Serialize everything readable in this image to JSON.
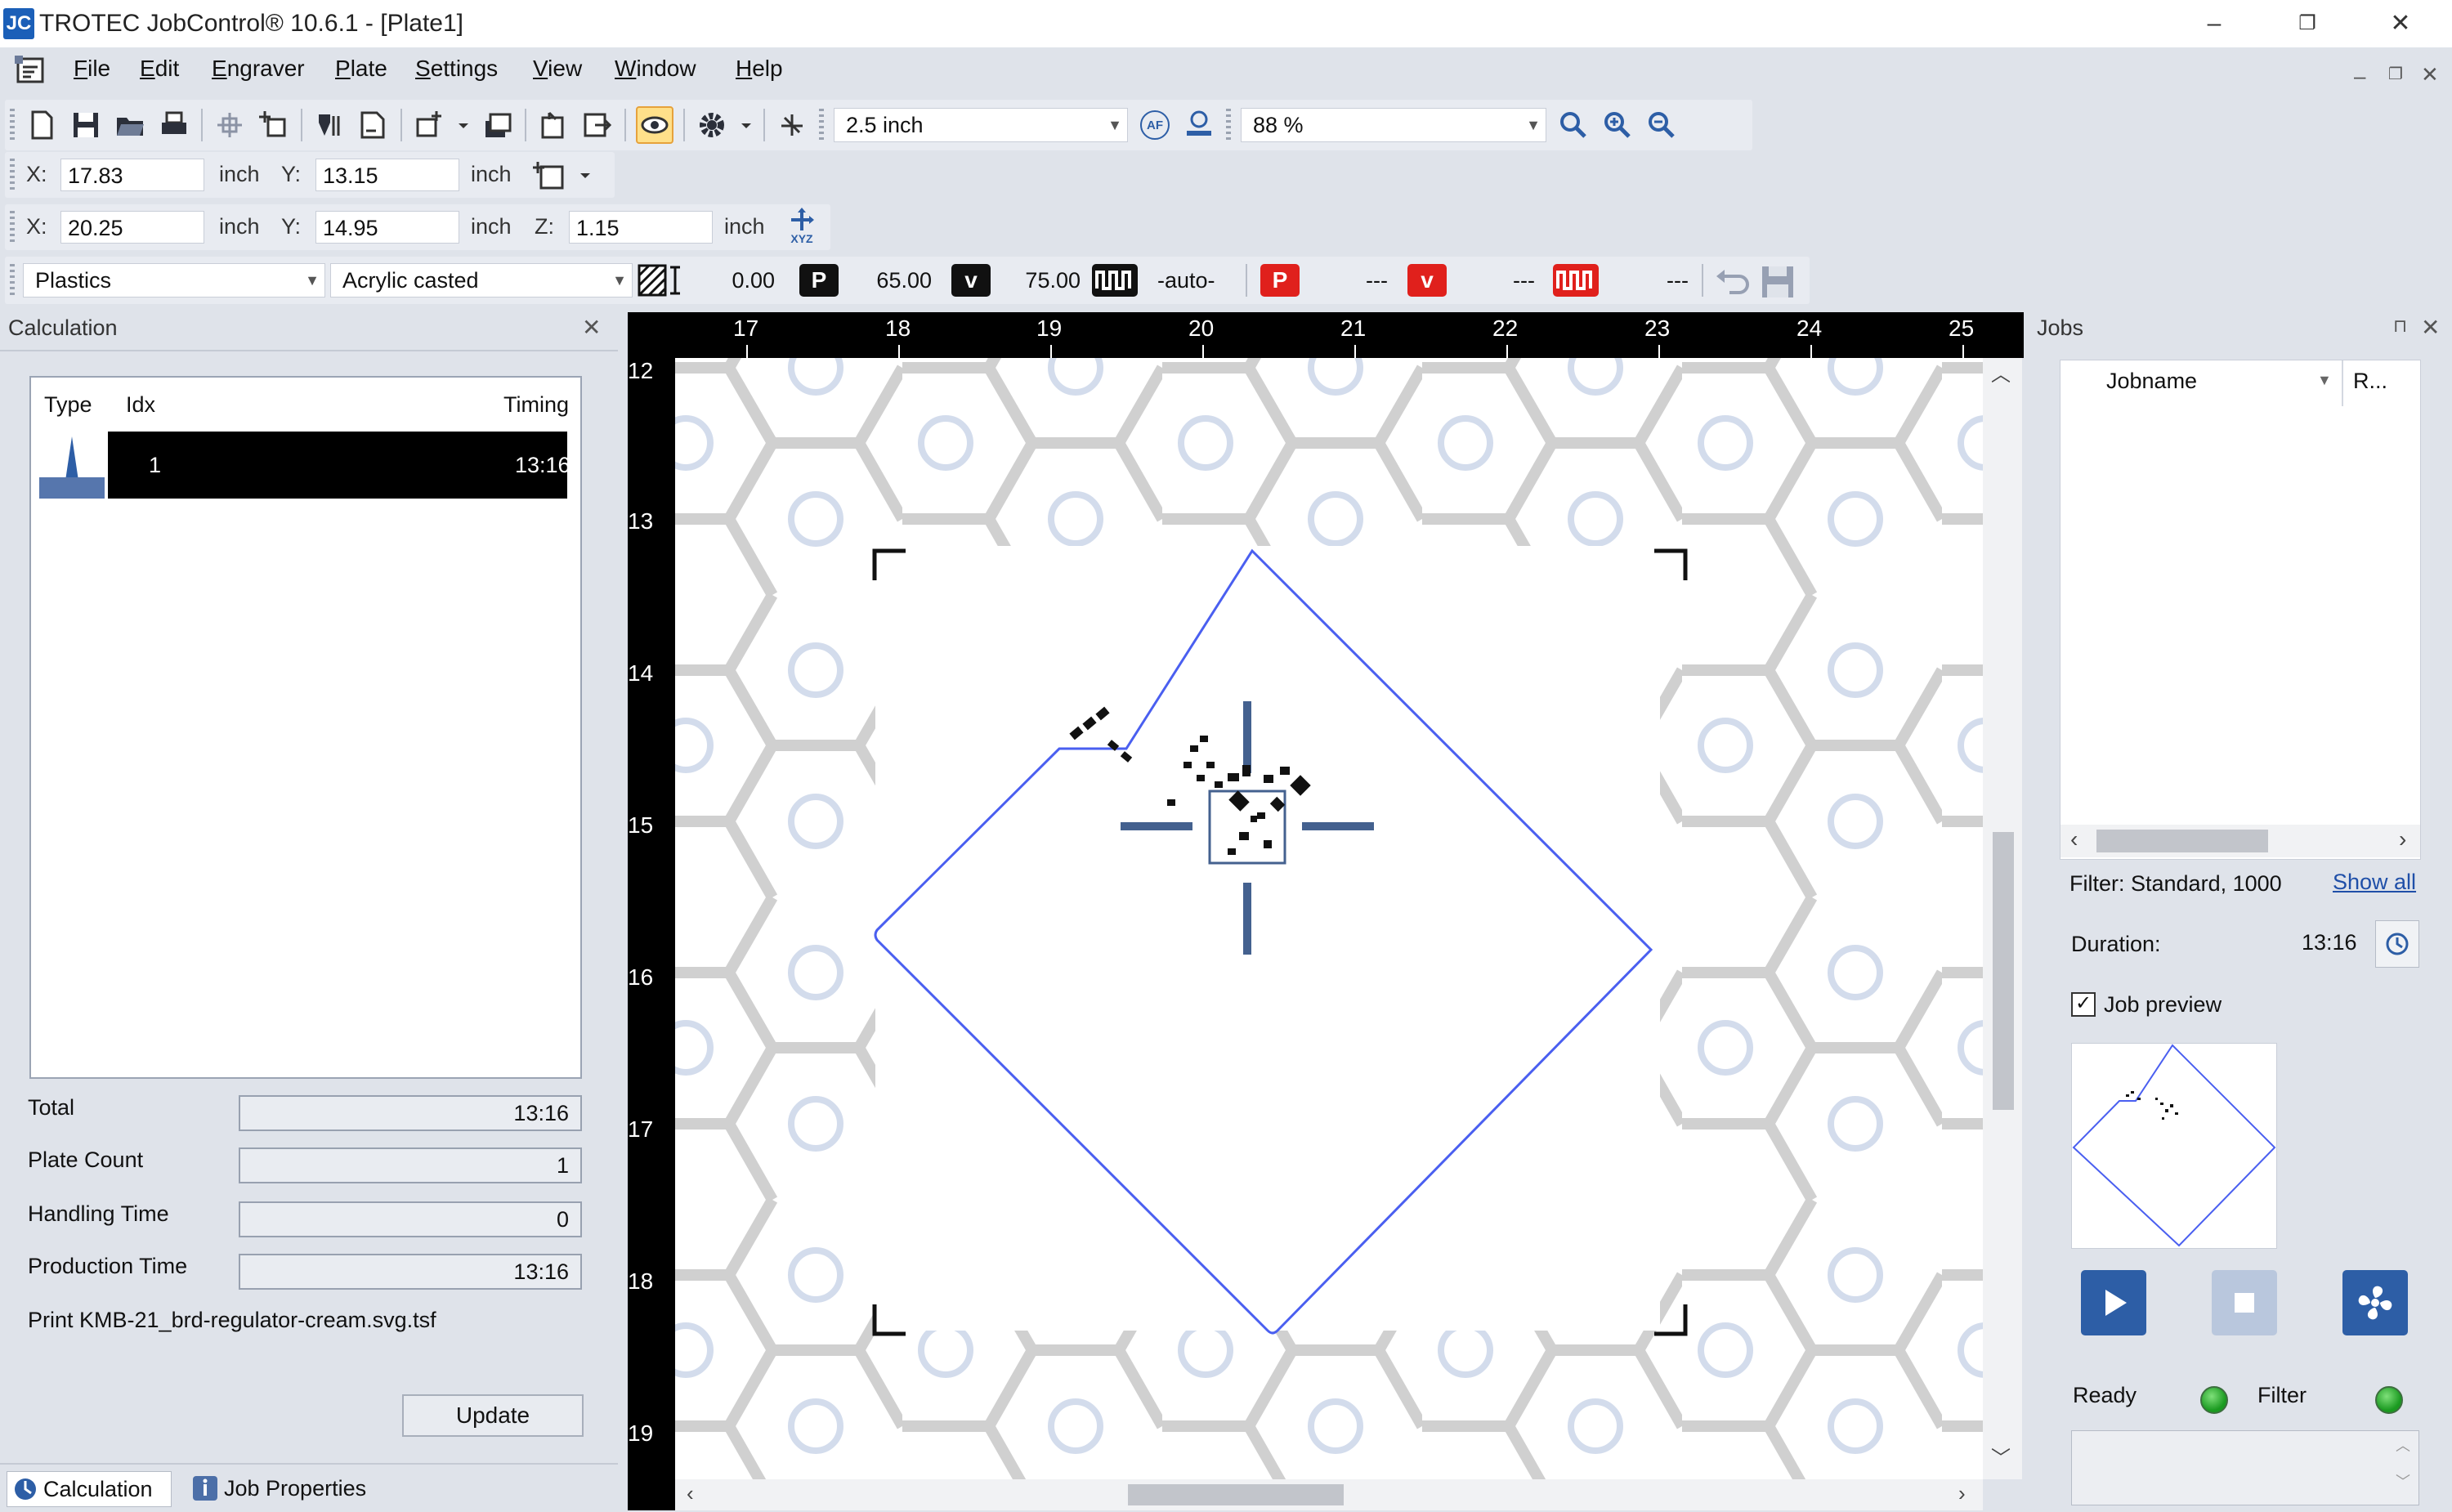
{
  "window": {
    "logo": "JC",
    "title": "TROTEC JobControl® 10.6.1 - [Plate1]",
    "controls": {
      "minimize": "–",
      "restore": "❐",
      "close": "✕"
    }
  },
  "menu": {
    "items": [
      {
        "ul": "F",
        "rest": "ile"
      },
      {
        "ul": "E",
        "rest": "dit"
      },
      {
        "ul": "E",
        "rest": "ngraver"
      },
      {
        "ul": "P",
        "rest": "late"
      },
      {
        "ul": "S",
        "rest": "ettings"
      },
      {
        "ul": "V",
        "rest": "iew"
      },
      {
        "ul": "W",
        "rest": "indow"
      },
      {
        "ul": "H",
        "rest": "elp"
      }
    ],
    "mdi": {
      "minimize": "–",
      "restore": "❐",
      "close": "✕"
    }
  },
  "toolbar": {
    "height_option": "2.5 inch",
    "af_label": "AF",
    "zoom": "88 %"
  },
  "position_bar": {
    "x_label": "X:",
    "x_value": "17.83",
    "unit1": "inch",
    "y_label": "Y:",
    "y_value": "13.15",
    "unit2": "inch"
  },
  "size_bar": {
    "x_label": "X:",
    "x_value": "20.25",
    "unit1": "inch",
    "y_label": "Y:",
    "y_value": "14.95",
    "unit2": "inch",
    "z_label": "Z:",
    "z_value": "1.15",
    "unit3": "inch",
    "xyz_label": "XYZ"
  },
  "material_bar": {
    "material": "Plastics",
    "subtype": "Acrylic casted",
    "offset_value": "0.00",
    "p_label": "P",
    "power": "65.00",
    "v_label": "v",
    "velocity": "75.00",
    "freq": "-auto-",
    "p2_label": "P",
    "p2_value": "---",
    "v2_label": "v",
    "v2_value": "---",
    "f2_value": "---"
  },
  "calculation": {
    "header": "Calculation",
    "close": "✕",
    "columns": [
      "Type",
      "Idx",
      "Timing"
    ],
    "row": {
      "idx": "1",
      "timing": "13:16"
    },
    "summary": [
      {
        "label": "Total",
        "value": "13:16"
      },
      {
        "label": "Plate Count",
        "value": "1"
      },
      {
        "label": "Handling Time",
        "value": "0"
      },
      {
        "label": "Production Time",
        "value": "13:16"
      }
    ],
    "print_file": "Print KMB-21_brd-regulator-cream.svg.tsf",
    "update_button": "Update",
    "tabs": [
      "Calculation",
      "Job Properties"
    ]
  },
  "rulers": {
    "top": [
      "17",
      "18",
      "19",
      "20",
      "21",
      "22",
      "23",
      "24",
      "25"
    ],
    "left": [
      "12",
      "13",
      "14",
      "15",
      "16",
      "17",
      "18",
      "19"
    ]
  },
  "jobs": {
    "header": "Jobs",
    "pin": "⊓",
    "close": "✕",
    "col_jobname": "Jobname",
    "col_r": "R...",
    "filter_text": "Filter: Standard, 1000",
    "show_all": "Show all",
    "duration_label": "Duration:",
    "duration_value": "13:16",
    "job_preview_label": "Job preview",
    "job_preview_checked": "✓",
    "ready_label": "Ready",
    "filter_label": "Filter"
  },
  "colors": {
    "accent_blue": "#4a5ff0",
    "crosshair": "#44618f",
    "play_button": "#2d5ea6",
    "status_green": "#2bb32f",
    "badge_red": "#e0201c"
  }
}
